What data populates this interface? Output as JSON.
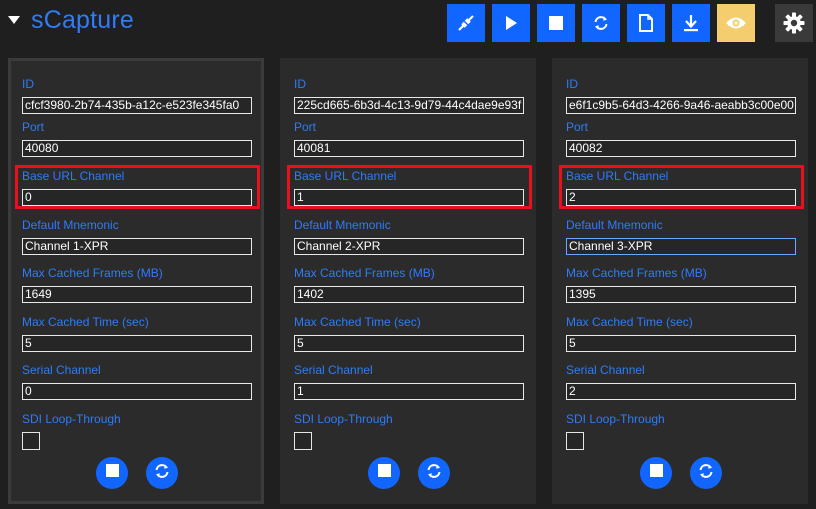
{
  "app": {
    "title": "sCapture"
  },
  "toolbar": {
    "buttons": [
      {
        "icon": "connect-icon",
        "color": "#1166ff"
      },
      {
        "icon": "play-icon",
        "color": "#1166ff"
      },
      {
        "icon": "stop-icon",
        "color": "#1166ff"
      },
      {
        "icon": "refresh-icon",
        "color": "#1166ff"
      },
      {
        "icon": "file-icon",
        "color": "#1166ff"
      },
      {
        "icon": "download-icon",
        "color": "#1166ff"
      },
      {
        "icon": "eye-icon",
        "color": "#f4cd6e"
      },
      {
        "icon": "gear-icon",
        "color": "#3a3a3a"
      }
    ]
  },
  "labels": {
    "id": "ID",
    "port": "Port",
    "base_url_channel": "Base URL Channel",
    "default_mnemonic": "Default Mnemonic",
    "max_cached_frames": "Max Cached Frames (MB)",
    "max_cached_time": "Max Cached Time (sec)",
    "serial_channel": "Serial Channel",
    "sdi_loop_through": "SDI Loop-Through"
  },
  "colors": {
    "accent": "#2f7cf6",
    "highlight": "#e8101c",
    "panel": "#2b2b2b",
    "background": "#1f1f1f"
  },
  "channels": [
    {
      "id": "cfcf3980-2b74-435b-a12c-e523fe345fa0",
      "port": "40080",
      "base_url_channel": "0",
      "default_mnemonic": "Channel 1-XPR",
      "max_cached_frames": "1649",
      "max_cached_time": "5",
      "serial_channel": "0",
      "sdi_loop_through": false
    },
    {
      "id": "225cd665-6b3d-4c13-9d79-44c4dae9e93f",
      "port": "40081",
      "base_url_channel": "1",
      "default_mnemonic": "Channel 2-XPR",
      "max_cached_frames": "1402",
      "max_cached_time": "5",
      "serial_channel": "1",
      "sdi_loop_through": false
    },
    {
      "id": "e6f1c9b5-64d3-4266-9a46-aeabb3c00e00",
      "port": "40082",
      "base_url_channel": "2",
      "default_mnemonic": "Channel 3-XPR",
      "max_cached_frames": "1395",
      "max_cached_time": "5",
      "serial_channel": "2",
      "sdi_loop_through": false
    }
  ]
}
